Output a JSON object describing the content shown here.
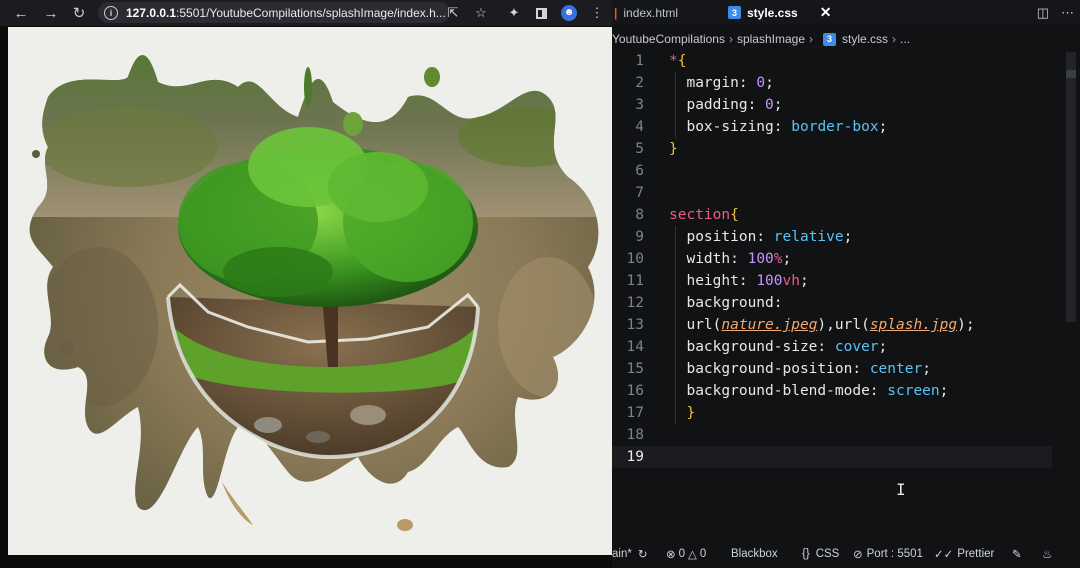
{
  "browser": {
    "url_host": "127.0.0.1",
    "url_rest": ":5501/YoutubeCompilations/splashImage/index.h...",
    "back_icon": "arrow-left-icon",
    "forward_icon": "arrow-right-icon",
    "reload_icon": "reload-icon"
  },
  "editor": {
    "tabs": [
      {
        "label": "index.html"
      },
      {
        "label": "style.css",
        "active": true
      }
    ],
    "breadcrumb": [
      "YoutubeCompilations",
      "splashImage",
      "style.css",
      "..."
    ],
    "lines": [
      {
        "n": "1",
        "parts": [
          [
            "sel",
            "*"
          ],
          [
            "brace",
            "{"
          ]
        ]
      },
      {
        "n": "2",
        "parts": [
          [
            "punc",
            "  "
          ],
          [
            "prop",
            "margin"
          ],
          [
            "punc",
            ": "
          ],
          [
            "num",
            "0"
          ],
          [
            "punc",
            ";"
          ]
        ]
      },
      {
        "n": "3",
        "parts": [
          [
            "punc",
            "  "
          ],
          [
            "prop",
            "padding"
          ],
          [
            "punc",
            ": "
          ],
          [
            "num",
            "0"
          ],
          [
            "punc",
            ";"
          ]
        ]
      },
      {
        "n": "4",
        "parts": [
          [
            "punc",
            "  "
          ],
          [
            "prop",
            "box-sizing"
          ],
          [
            "punc",
            ": "
          ],
          [
            "val",
            "border-box"
          ],
          [
            "punc",
            ";"
          ]
        ]
      },
      {
        "n": "5",
        "parts": [
          [
            "brace",
            "}"
          ]
        ]
      },
      {
        "n": "6",
        "parts": []
      },
      {
        "n": "7",
        "parts": []
      },
      {
        "n": "8",
        "parts": [
          [
            "sel",
            "section"
          ],
          [
            "brace",
            "{"
          ]
        ]
      },
      {
        "n": "9",
        "parts": [
          [
            "punc",
            "  "
          ],
          [
            "prop",
            "position"
          ],
          [
            "punc",
            ": "
          ],
          [
            "val",
            "relative"
          ],
          [
            "punc",
            ";"
          ]
        ]
      },
      {
        "n": "10",
        "parts": [
          [
            "punc",
            "  "
          ],
          [
            "prop",
            "width"
          ],
          [
            "punc",
            ": "
          ],
          [
            "num",
            "100"
          ],
          [
            "sel",
            "%"
          ],
          [
            "punc",
            ";"
          ]
        ]
      },
      {
        "n": "11",
        "parts": [
          [
            "punc",
            "  "
          ],
          [
            "prop",
            "height"
          ],
          [
            "punc",
            ": "
          ],
          [
            "num",
            "100"
          ],
          [
            "sel",
            "vh"
          ],
          [
            "punc",
            ";"
          ]
        ]
      },
      {
        "n": "12",
        "parts": [
          [
            "punc",
            "  "
          ],
          [
            "prop",
            "background"
          ],
          [
            "punc",
            ":"
          ]
        ]
      },
      {
        "n": "13",
        "parts": [
          [
            "punc",
            "  "
          ],
          [
            "fn",
            "url("
          ],
          [
            "arg",
            "nature.jpeg"
          ],
          [
            "fn",
            ")"
          ],
          [
            "punc",
            ","
          ],
          [
            "fn",
            "url("
          ],
          [
            "arg",
            "splash.jpg"
          ],
          [
            "fn",
            ")"
          ],
          [
            "punc",
            ";"
          ]
        ]
      },
      {
        "n": "14",
        "parts": [
          [
            "punc",
            "  "
          ],
          [
            "prop",
            "background-size"
          ],
          [
            "punc",
            ": "
          ],
          [
            "val",
            "cover"
          ],
          [
            "punc",
            ";"
          ]
        ]
      },
      {
        "n": "15",
        "parts": [
          [
            "punc",
            "  "
          ],
          [
            "prop",
            "background-position"
          ],
          [
            "punc",
            ": "
          ],
          [
            "val",
            "center"
          ],
          [
            "punc",
            ";"
          ]
        ]
      },
      {
        "n": "16",
        "parts": [
          [
            "punc",
            "  "
          ],
          [
            "prop",
            "background-blend-mode"
          ],
          [
            "punc",
            ": "
          ],
          [
            "val",
            "screen"
          ],
          [
            "punc",
            ";"
          ]
        ]
      },
      {
        "n": "17",
        "parts": [
          [
            "punc",
            "  "
          ],
          [
            "brace",
            "}"
          ]
        ]
      },
      {
        "n": "18",
        "parts": []
      },
      {
        "n": "19",
        "parts": [],
        "current": true
      }
    ],
    "status": {
      "branch": "ain*",
      "errors": "0",
      "warnings": "0",
      "blackbox": "Blackbox",
      "language": "CSS",
      "port": "Port : 5501",
      "prettier": "Prettier"
    }
  },
  "colors": {
    "selector": "#ef5a8c",
    "value": "#58c4f5",
    "number": "#c695ff",
    "brace": "#f0c13d",
    "argument": "#f2a86f"
  }
}
